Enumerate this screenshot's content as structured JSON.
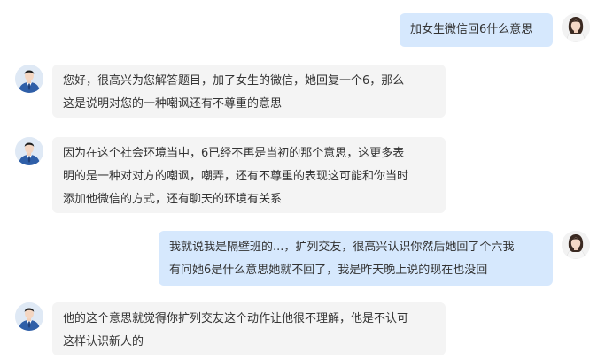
{
  "messages": [
    {
      "role": "user",
      "text": "加女生微信回6什么意思"
    },
    {
      "role": "expert",
      "text": "您好，很高兴为您解答题目，加了女生的微信，她回复一个6，那么\n这是说明对您的一种嘲讽还有不尊重的意思"
    },
    {
      "role": "expert",
      "text": "因为在这个社会环境当中，6已经不再是当初的那个意思，这更多表\n明的是一种对对方的嘲讽，嘲弄，还有不尊重的表现这可能和你当时\n添加他微信的方式，还有聊天的环境有关系"
    },
    {
      "role": "user",
      "text": "我就说我是隔壁班的...，扩列交友，很高兴认识你然后她回了个六我\n有问她6是什么意思她就不回了，我是昨天晚上说的现在也没回"
    },
    {
      "role": "expert",
      "text": "他的这个意思就觉得你扩列交友这个动作让他很不理解，他是不认可\n这样认识新人的"
    }
  ],
  "avatars": {
    "user": "female-avatar",
    "expert": "male-avatar"
  },
  "colors": {
    "user_bubble": "#d6e8fd",
    "expert_bubble": "#f4f4f4",
    "text": "#333333"
  }
}
